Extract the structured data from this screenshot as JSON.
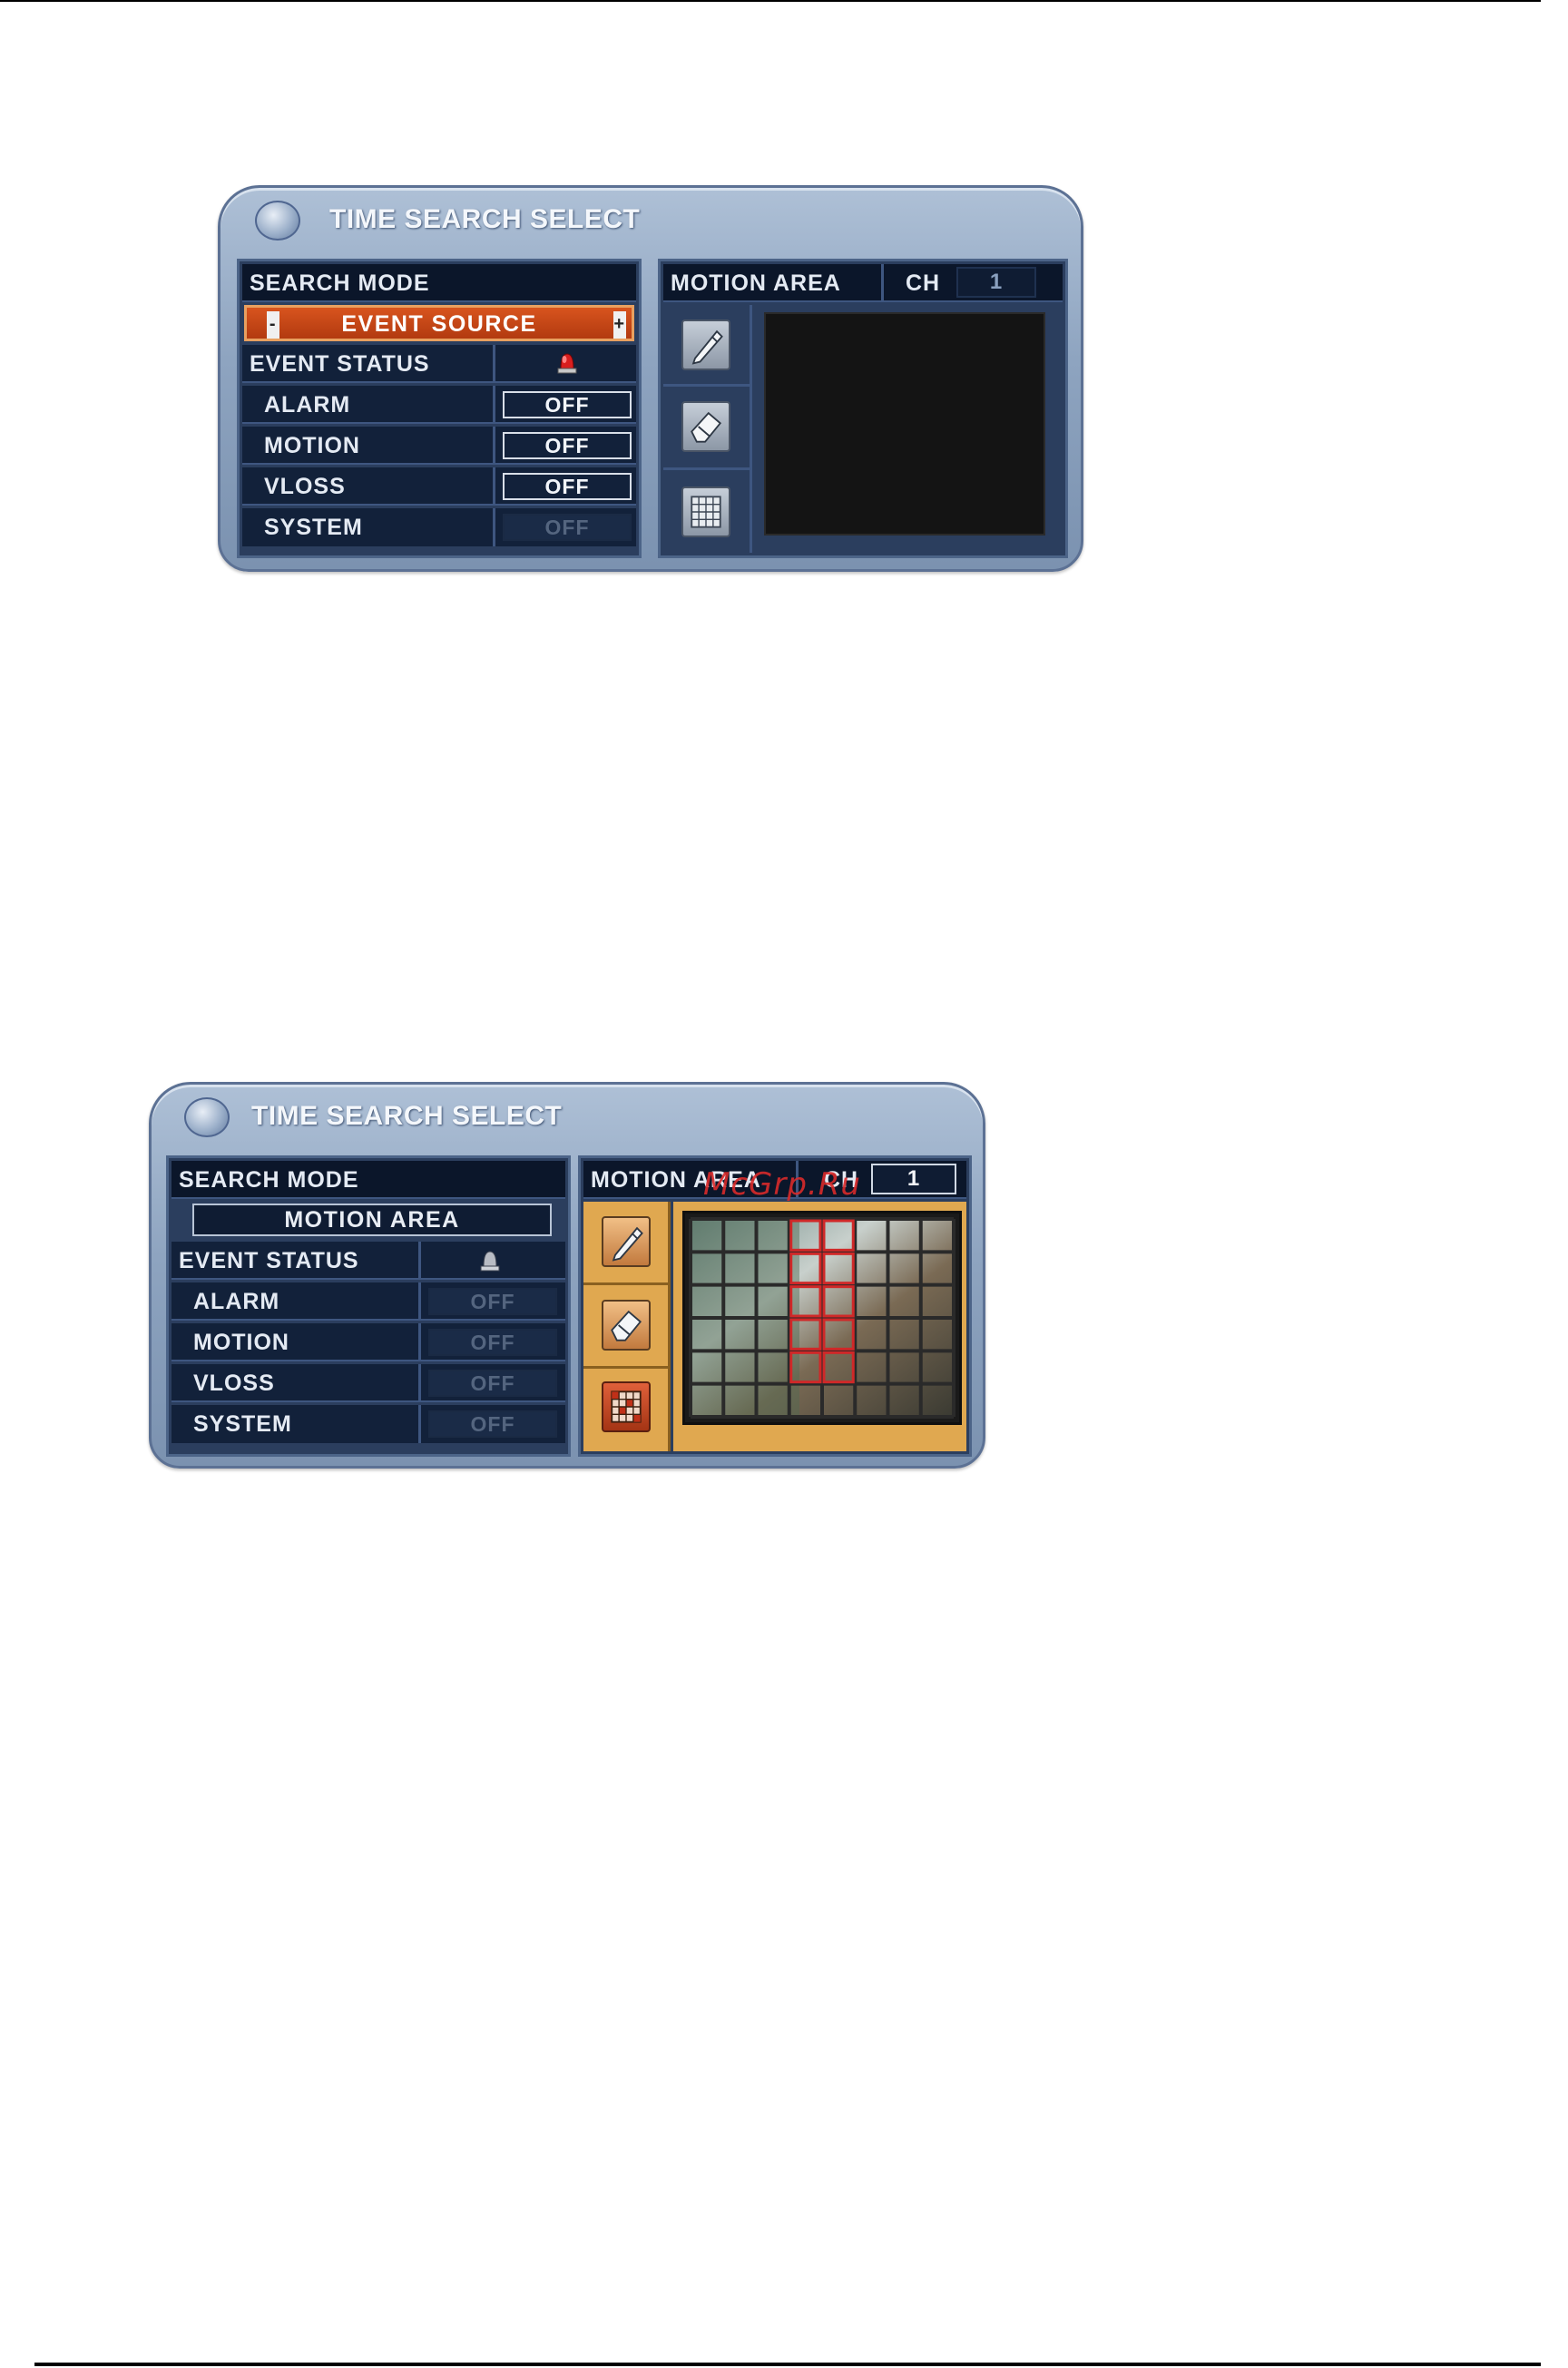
{
  "dialog1": {
    "title": "TIME SEARCH SELECT",
    "search_mode_label": "SEARCH MODE",
    "search_mode_value": "EVENT SOURCE",
    "minus": "-",
    "plus": "+",
    "event_status_label": "EVENT STATUS",
    "rows": [
      {
        "label": "ALARM",
        "value": "OFF"
      },
      {
        "label": "MOTION",
        "value": "OFF"
      },
      {
        "label": "VLOSS",
        "value": "OFF"
      },
      {
        "label": "SYSTEM",
        "value": "OFF"
      }
    ],
    "motion_area_label": "MOTION AREA",
    "ch_label": "CH",
    "ch_value": "1"
  },
  "dialog2": {
    "title": "TIME SEARCH SELECT",
    "search_mode_label": "SEARCH MODE",
    "search_mode_value": "MOTION AREA",
    "event_status_label": "EVENT STATUS",
    "rows": [
      {
        "label": "ALARM",
        "value": "OFF"
      },
      {
        "label": "MOTION",
        "value": "OFF"
      },
      {
        "label": "VLOSS",
        "value": "OFF"
      },
      {
        "label": "SYSTEM",
        "value": "OFF"
      }
    ],
    "motion_area_label": "MOTION AREA",
    "ch_label": "CH",
    "ch_value": "1"
  },
  "watermark": "McGrp.Ru",
  "icons": {
    "alarm": "alarm-light-icon",
    "bell": "bell-icon",
    "pencil": "pencil-icon",
    "eraser": "eraser-icon",
    "grid": "grid-icon"
  },
  "colors": {
    "accent_orange": "#c8461a",
    "panel_dark": "#12213a",
    "frame_blue": "#8ea4c0",
    "highlight_frame": "#e0a850",
    "motion_red": "#d02828"
  }
}
